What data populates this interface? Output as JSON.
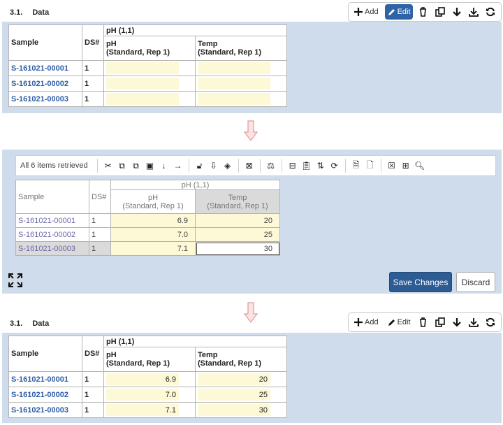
{
  "section": {
    "number": "3.1.",
    "title": "Data"
  },
  "toolbar": {
    "add_label": "Add",
    "edit_label": "Edit"
  },
  "grid": {
    "header_group": "pH (1,1)",
    "col_sample": "Sample",
    "col_ds": "DS#",
    "col_ph_line1": "pH",
    "col_ph_line2": "(Standard, Rep 1)",
    "col_temp_line1": "Temp",
    "col_temp_line2": "(Standard, Rep 1)"
  },
  "rows_empty": [
    {
      "sample": "S-161021-00001",
      "ds": "1"
    },
    {
      "sample": "S-161021-00002",
      "ds": "1"
    },
    {
      "sample": "S-161021-00003",
      "ds": "1"
    }
  ],
  "rows": [
    {
      "sample": "S-161021-00001",
      "ds": "1",
      "ph": "6.9",
      "temp": "20"
    },
    {
      "sample": "S-161021-00002",
      "ds": "1",
      "ph": "7.0",
      "temp": "25"
    },
    {
      "sample": "S-161021-00003",
      "ds": "1",
      "ph": "7.1",
      "temp": "30"
    }
  ],
  "editor": {
    "status": "All 6 items retrieved",
    "save_label": "Save Changes",
    "discard_label": "Discard"
  },
  "colors": {
    "panel": "#cfdcec",
    "accent": "#2d5b93",
    "cell_fill": "#fdf8d6",
    "arrow": "#f2b8b8"
  }
}
